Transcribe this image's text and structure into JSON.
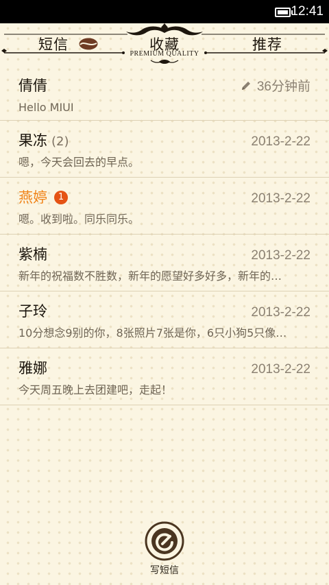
{
  "status_bar": {
    "time": "12:41"
  },
  "tabs": {
    "sms": "短信",
    "favorites": "收藏",
    "recommend": "推荐",
    "tagline": "PREMIUM QUALITY"
  },
  "conversations": [
    {
      "name": "倩倩",
      "count": "",
      "badge": "",
      "time": "36分钟前",
      "preview": "Hello MIUI",
      "unread": false,
      "draft": true
    },
    {
      "name": "果冻",
      "count": "(2)",
      "badge": "",
      "time": "2013-2-22",
      "preview": "嗯，今天会回去的早点。",
      "unread": false,
      "draft": false
    },
    {
      "name": "燕婷",
      "count": "",
      "badge": "1",
      "time": "2013-2-22",
      "preview": "嗯。收到啦。同乐同乐。",
      "unread": true,
      "draft": false
    },
    {
      "name": "紫楠",
      "count": "",
      "badge": "",
      "time": "2013-2-22",
      "preview": "新年的祝福数不胜数，新年的愿望好多好多，新年的…",
      "unread": false,
      "draft": false
    },
    {
      "name": "子玲",
      "count": "",
      "badge": "",
      "time": "2013-2-22",
      "preview": "10分想念9别的你，8张照片7张是你，6只小狗5只像…",
      "unread": false,
      "draft": false
    },
    {
      "name": "雅娜",
      "count": "",
      "badge": "",
      "time": "2013-2-22",
      "preview": "今天周五晚上去团建吧，走起！",
      "unread": false,
      "draft": false
    }
  ],
  "compose": {
    "label": "写短信"
  },
  "colors": {
    "accent_unread": "#f08318",
    "badge": "#e55314",
    "compose_ring": "#4a3520",
    "background": "#fbf5e2"
  },
  "icons": {
    "draft": "pencil-icon",
    "sms_tab": "coffee-bean-icon",
    "compose": "compose-icon",
    "battery": "battery-icon"
  }
}
